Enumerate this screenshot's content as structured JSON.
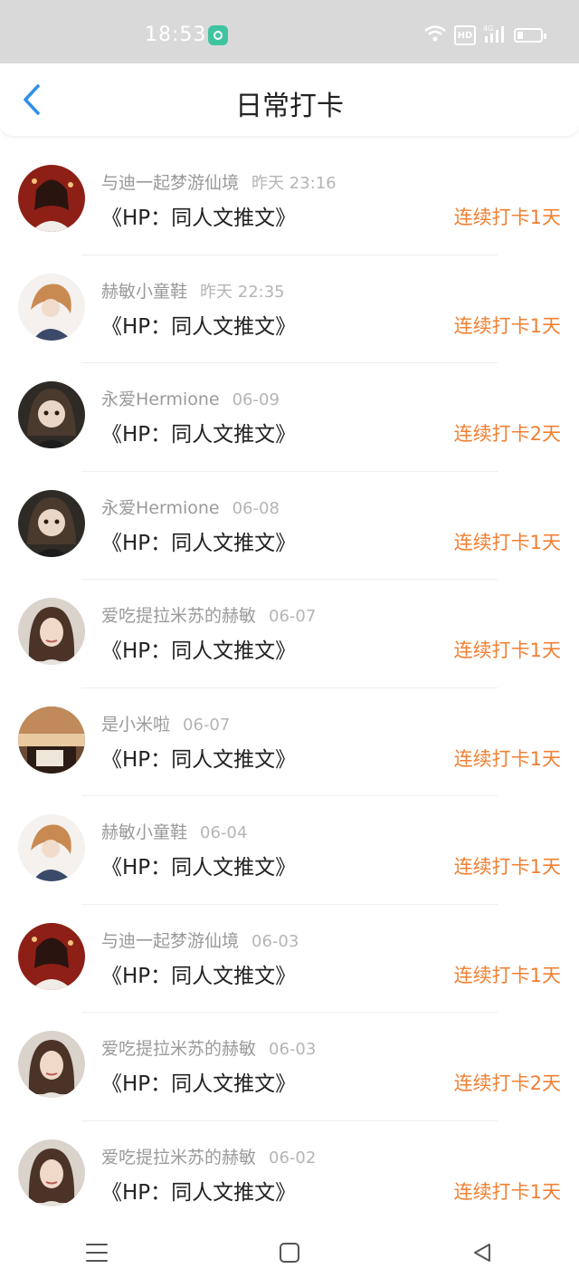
{
  "status_bar": {
    "time": "18:53",
    "icons": [
      "app-notification-icon",
      "wifi-icon",
      "hd-icon",
      "4g-signal-icon",
      "battery-icon"
    ],
    "hd_label": "HD",
    "network_label": "4G"
  },
  "header": {
    "title": "日常打卡",
    "back_icon": "chevron-left-icon"
  },
  "colors": {
    "accent_blue": "#2f8fe8",
    "streak_orange": "#f08033",
    "meta_gray": "#9a9a9a"
  },
  "checkins": [
    {
      "name": "与迪一起梦游仙境",
      "time": "昨天 23:16",
      "book": "《HP：同人文推文》",
      "streak": "连续打卡1天",
      "avatar": "avatar-1"
    },
    {
      "name": "赫敏小童鞋",
      "time": "昨天 22:35",
      "book": "《HP：同人文推文》",
      "streak": "连续打卡1天",
      "avatar": "avatar-2"
    },
    {
      "name": "永爱Hermione",
      "time": "06-09",
      "book": "《HP：同人文推文》",
      "streak": "连续打卡2天",
      "avatar": "avatar-3"
    },
    {
      "name": "永爱Hermione",
      "time": "06-08",
      "book": "《HP：同人文推文》",
      "streak": "连续打卡1天",
      "avatar": "avatar-3"
    },
    {
      "name": "爱吃提拉米苏的赫敏",
      "time": "06-07",
      "book": "《HP：同人文推文》",
      "streak": "连续打卡1天",
      "avatar": "avatar-4"
    },
    {
      "name": "是小米啦",
      "time": "06-07",
      "book": "《HP：同人文推文》",
      "streak": "连续打卡1天",
      "avatar": "avatar-5"
    },
    {
      "name": "赫敏小童鞋",
      "time": "06-04",
      "book": "《HP：同人文推文》",
      "streak": "连续打卡1天",
      "avatar": "avatar-2"
    },
    {
      "name": "与迪一起梦游仙境",
      "time": "06-03",
      "book": "《HP：同人文推文》",
      "streak": "连续打卡1天",
      "avatar": "avatar-1"
    },
    {
      "name": "爱吃提拉米苏的赫敏",
      "time": "06-03",
      "book": "《HP：同人文推文》",
      "streak": "连续打卡2天",
      "avatar": "avatar-4"
    },
    {
      "name": "爱吃提拉米苏的赫敏",
      "time": "06-02",
      "book": "《HP：同人文推文》",
      "streak": "连续打卡1天",
      "avatar": "avatar-4"
    }
  ],
  "nav_bar": {
    "icons": [
      "menu-icon",
      "home-square-icon",
      "back-triangle-icon"
    ]
  }
}
